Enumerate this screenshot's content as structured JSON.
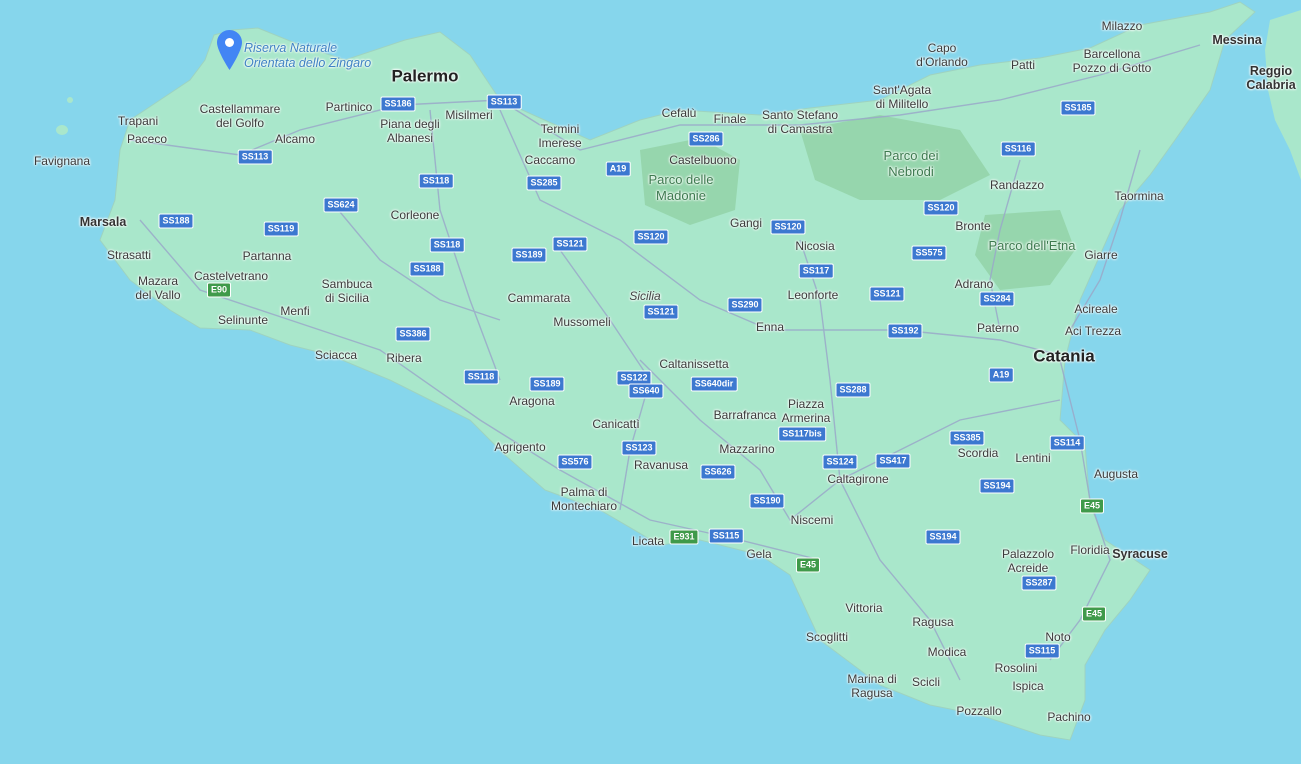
{
  "colors": {
    "sea": "#86d6ec",
    "land": "#a9e7cb",
    "park": "#8fcf9f",
    "road": "#9aa9c9",
    "pin": "#4285f4"
  },
  "marker": {
    "icon": "map-pin-icon",
    "label": "Riserva Naturale\nOrientata dello Zingaro"
  },
  "places": [
    {
      "name": "Palermo",
      "kind": "city"
    },
    {
      "name": "Catania",
      "kind": "city"
    },
    {
      "name": "Messina",
      "kind": "town"
    },
    {
      "name": "Marsala",
      "kind": "town"
    },
    {
      "name": "Syracuse",
      "kind": "town"
    },
    {
      "name": "Reggio\nCalabria",
      "kind": "town"
    },
    {
      "name": "Milazzo",
      "kind": "place"
    },
    {
      "name": "Barcellona\nPozzo di Gotto",
      "kind": "place"
    },
    {
      "name": "Patti",
      "kind": "place"
    },
    {
      "name": "Capo\nd'Orlando",
      "kind": "place"
    },
    {
      "name": "Sant'Agata\ndi Militello",
      "kind": "place"
    },
    {
      "name": "Santo Stefano\ndi Camastra",
      "kind": "place"
    },
    {
      "name": "Cefalù",
      "kind": "place"
    },
    {
      "name": "Finale",
      "kind": "place"
    },
    {
      "name": "Termini\nImerese",
      "kind": "place"
    },
    {
      "name": "Caccamo",
      "kind": "place"
    },
    {
      "name": "Misilmeri",
      "kind": "place"
    },
    {
      "name": "Partinico",
      "kind": "place"
    },
    {
      "name": "Piana degli\nAlbanesi",
      "kind": "place"
    },
    {
      "name": "Castellammare\ndel Golfo",
      "kind": "place"
    },
    {
      "name": "Alcamo",
      "kind": "place"
    },
    {
      "name": "Trapani",
      "kind": "place"
    },
    {
      "name": "Paceco",
      "kind": "place"
    },
    {
      "name": "Favignana",
      "kind": "place"
    },
    {
      "name": "Strasatti",
      "kind": "place"
    },
    {
      "name": "Mazara\ndel Vallo",
      "kind": "place"
    },
    {
      "name": "Castelvetrano",
      "kind": "place"
    },
    {
      "name": "Partanna",
      "kind": "place"
    },
    {
      "name": "Menfi",
      "kind": "place"
    },
    {
      "name": "Selinunte",
      "kind": "place"
    },
    {
      "name": "Sambuca\ndi Sicilia",
      "kind": "place"
    },
    {
      "name": "Corleone",
      "kind": "place"
    },
    {
      "name": "Sciacca",
      "kind": "place"
    },
    {
      "name": "Ribera",
      "kind": "place"
    },
    {
      "name": "Cammarata",
      "kind": "place"
    },
    {
      "name": "Mussomeli",
      "kind": "place"
    },
    {
      "name": "Sicilia",
      "kind": "region"
    },
    {
      "name": "Aragona",
      "kind": "place"
    },
    {
      "name": "Agrigento",
      "kind": "place"
    },
    {
      "name": "Canicattì",
      "kind": "place"
    },
    {
      "name": "Palma di\nMontechiaro",
      "kind": "place"
    },
    {
      "name": "Ravanusa",
      "kind": "place"
    },
    {
      "name": "Licata",
      "kind": "place"
    },
    {
      "name": "Caltanissetta",
      "kind": "place"
    },
    {
      "name": "Enna",
      "kind": "place"
    },
    {
      "name": "Barrafranca",
      "kind": "place"
    },
    {
      "name": "Mazzarino",
      "kind": "place"
    },
    {
      "name": "Piazza\nArmerina",
      "kind": "place"
    },
    {
      "name": "Gela",
      "kind": "place"
    },
    {
      "name": "Niscemi",
      "kind": "place"
    },
    {
      "name": "Caltagirone",
      "kind": "place"
    },
    {
      "name": "Castelbuono",
      "kind": "place"
    },
    {
      "name": "Parco delle\nMadonie",
      "kind": "park"
    },
    {
      "name": "Parco dei\nNebrodi",
      "kind": "park"
    },
    {
      "name": "Parco dell'Etna",
      "kind": "park"
    },
    {
      "name": "Gangi",
      "kind": "place"
    },
    {
      "name": "Nicosia",
      "kind": "place"
    },
    {
      "name": "Leonforte",
      "kind": "place"
    },
    {
      "name": "Randazzo",
      "kind": "place"
    },
    {
      "name": "Bronte",
      "kind": "place"
    },
    {
      "name": "Adrano",
      "kind": "place"
    },
    {
      "name": "Paterno",
      "kind": "place"
    },
    {
      "name": "Taormina",
      "kind": "place"
    },
    {
      "name": "Giarre",
      "kind": "place"
    },
    {
      "name": "Acireale",
      "kind": "place"
    },
    {
      "name": "Aci Trezza",
      "kind": "place"
    },
    {
      "name": "Scordia",
      "kind": "place"
    },
    {
      "name": "Lentini",
      "kind": "place"
    },
    {
      "name": "Augusta",
      "kind": "place"
    },
    {
      "name": "Floridia",
      "kind": "place"
    },
    {
      "name": "Palazzolo\nAcreide",
      "kind": "place"
    },
    {
      "name": "Vittoria",
      "kind": "place"
    },
    {
      "name": "Scoglitti",
      "kind": "place"
    },
    {
      "name": "Ragusa",
      "kind": "place"
    },
    {
      "name": "Modica",
      "kind": "place"
    },
    {
      "name": "Marina di\nRagusa",
      "kind": "place"
    },
    {
      "name": "Scicli",
      "kind": "place"
    },
    {
      "name": "Pozzallo",
      "kind": "place"
    },
    {
      "name": "Ispica",
      "kind": "place"
    },
    {
      "name": "Rosolini",
      "kind": "place"
    },
    {
      "name": "Noto",
      "kind": "place"
    },
    {
      "name": "Pachino",
      "kind": "place"
    }
  ],
  "roads": [
    "SS186",
    "SS113",
    "SS113",
    "SS118",
    "SS285",
    "SS624",
    "SS188",
    "SS119",
    "SS118",
    "SS188",
    "E90",
    "SS386",
    "SS189",
    "SS121",
    "SS120",
    "SS286",
    "A19",
    "SS120",
    "SS117",
    "SS290",
    "SS121",
    "SS121",
    "SS185",
    "SS116",
    "SS120",
    "SS575",
    "SS284",
    "SS192",
    "A19",
    "SS118",
    "SS189",
    "SS122",
    "SS640",
    "SS640dir",
    "SS288",
    "SS117bis",
    "SS123",
    "SS576",
    "SS626",
    "SS124",
    "SS417",
    "SS385",
    "SS114",
    "SS194",
    "E45",
    "SS190",
    "E931",
    "SS115",
    "E45",
    "SS194",
    "SS287",
    "E45",
    "SS115"
  ]
}
